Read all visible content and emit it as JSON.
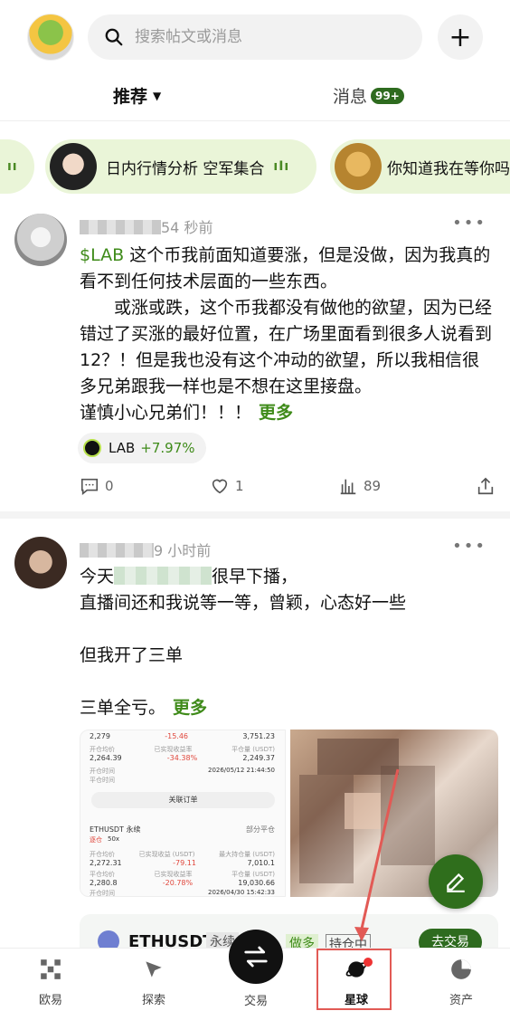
{
  "header": {
    "search_placeholder": "搜索帖文或消息",
    "add_label": "+"
  },
  "tabs": {
    "recommend": "推荐",
    "messages": "消息",
    "messages_badge": "99+"
  },
  "chips": [
    {
      "text": ""
    },
    {
      "text": "日内行情分析 空军集合"
    },
    {
      "text": "你知道我在等你吗"
    }
  ],
  "posts": [
    {
      "time": "54 秒前",
      "ticker": "$LAB",
      "lines": [
        " 这个币我前面知道要涨，但是没做，因为我真的看不到任何技术层面的一些东西。",
        "　　或涨或跌，这个币我都没有做他的欲望，因为已经错过了买涨的最好位置，在广场里面看到很多人说看到12？！但是我也没有这个冲动的欲望，所以我相信很多兄弟跟我一样也是不想在这里接盘。",
        "谨慎小心兄弟们！！！"
      ],
      "more": "更多",
      "coin": {
        "symbol": "LAB",
        "change": "+7.97%"
      },
      "comments": "0",
      "likes": "1",
      "views": "89"
    },
    {
      "time": "9 小时前",
      "line1_start": "今天",
      "line1_end": "很早下播，",
      "line2": "直播间还和我说等一等，曾颖，心态好一些",
      "line3": "但我开了三单",
      "line4": "三单全亏。",
      "more": "更多"
    }
  ],
  "trade_screenshot": {
    "r1": [
      "2,279",
      "-15.46",
      "3,751.23"
    ],
    "r2a": [
      "开仓均价",
      "已实现收益率",
      "平仓量 (USDT)"
    ],
    "r2": [
      "2,264.39",
      "-34.38%",
      "2,249.37"
    ],
    "r3a": [
      "开仓时间",
      "2026/05/12 21:44:50"
    ],
    "r3b": "平仓时间",
    "btn": "关联订单",
    "pair": "ETHUSDT 永续",
    "tag": "部分平仓",
    "sub": [
      "逐仓",
      "50x"
    ],
    "r4a": [
      "开仓均价",
      "已实现收益 (USDT)",
      "最大持仓量 (USDT)"
    ],
    "r4": [
      "2,272.31",
      "-79.11",
      "7,010.1"
    ],
    "r5a": [
      "平仓均价",
      "已实现收益率",
      "平仓量 (USDT)"
    ],
    "r5": [
      "2,280.8",
      "-20.78%",
      "19,030.66"
    ],
    "r6": [
      "开仓时间",
      "2026/04/30 15:42:33"
    ]
  },
  "eth_card": {
    "symbol": "ETHUSDT",
    "perp": "永续",
    "long": "做多",
    "hold": "持仓中",
    "go": "去交易"
  },
  "bottom_nav": {
    "home": "欧易",
    "explore": "探索",
    "trade": "交易",
    "planet": "星球",
    "assets": "资产"
  },
  "colors": {
    "brand_green": "#2e6b1f",
    "accent_green": "#3f8b1a",
    "loss_red": "#e0473c",
    "highlight_red": "#e25a55"
  }
}
